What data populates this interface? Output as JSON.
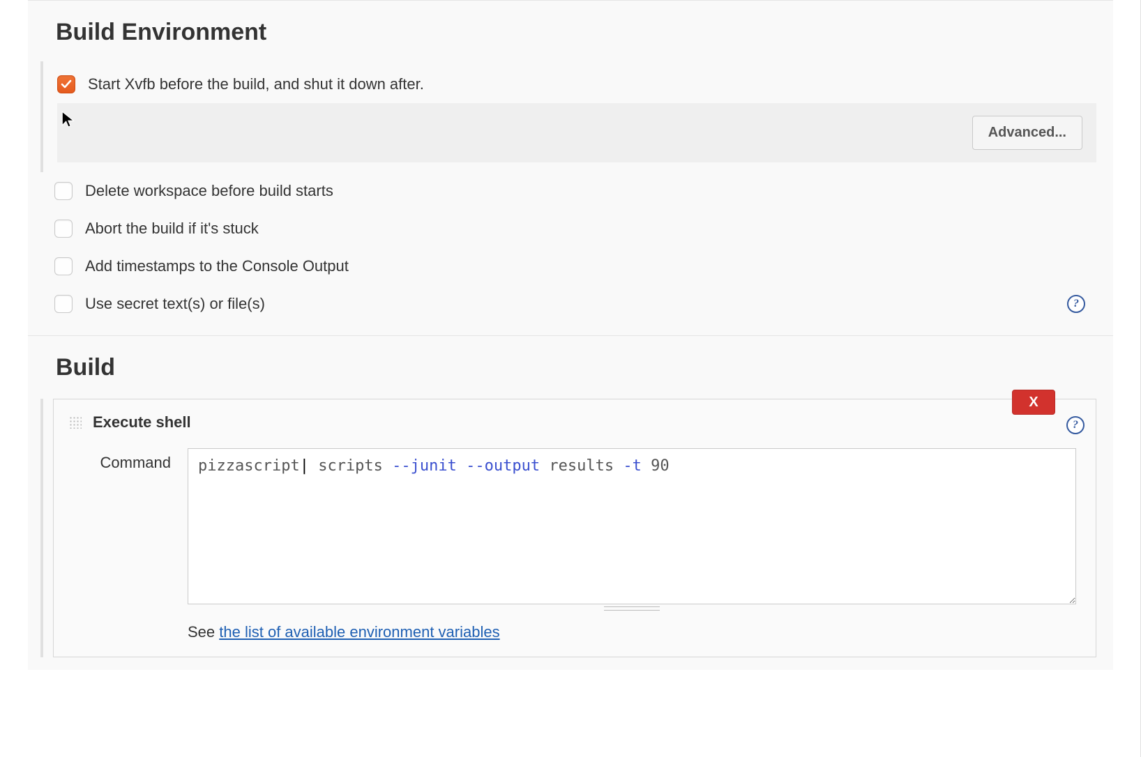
{
  "build_environment": {
    "title": "Build Environment",
    "options": [
      {
        "label": "Start Xvfb before the build, and shut it down after.",
        "checked": true,
        "expandable": true
      },
      {
        "label": "Delete workspace before build starts",
        "checked": false
      },
      {
        "label": "Abort the build if it's stuck",
        "checked": false
      },
      {
        "label": "Add timestamps to the Console Output",
        "checked": false
      },
      {
        "label": "Use secret text(s) or file(s)",
        "checked": false,
        "help": true
      }
    ],
    "advanced_button": "Advanced..."
  },
  "build": {
    "title": "Build",
    "step": {
      "title": "Execute shell",
      "close_label": "X",
      "command_label": "Command",
      "command_value": "pizzascript| scripts --junit --output results -t 90",
      "command_tokens": [
        {
          "t": "pizzascript",
          "c": "word"
        },
        {
          "t": "|",
          "c": "caret"
        },
        {
          "t": " scripts ",
          "c": "word"
        },
        {
          "t": "--junit",
          "c": "flag"
        },
        {
          "t": " ",
          "c": "word"
        },
        {
          "t": "--output",
          "c": "flag"
        },
        {
          "t": " results ",
          "c": "word"
        },
        {
          "t": "-t",
          "c": "flag"
        },
        {
          "t": " 90",
          "c": "word"
        }
      ],
      "env_hint_prefix": "See ",
      "env_hint_link": "the list of available environment variables"
    }
  }
}
